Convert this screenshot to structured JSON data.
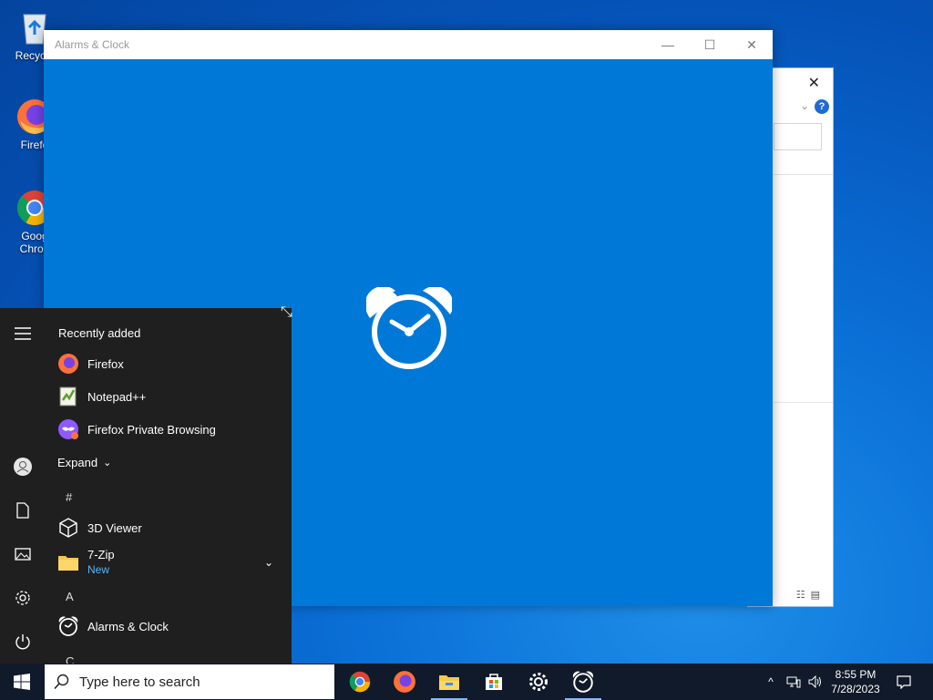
{
  "desktop": {
    "icons": [
      {
        "label": "Recycle",
        "icon": "recycle-bin-icon"
      },
      {
        "label": "Firefo",
        "icon": "firefox-icon"
      },
      {
        "label": "Goog Chron",
        "icon": "chrome-icon"
      }
    ]
  },
  "app_window": {
    "title": "Alarms & Clock",
    "minimize": "—",
    "maximize": "☐",
    "close": "✕",
    "accent": "#0078d7",
    "splash_icon": "alarm-clock-icon"
  },
  "background_window": {
    "close": "✕",
    "help": "?"
  },
  "start_menu": {
    "recently_added_label": "Recently added",
    "recent": [
      {
        "label": "Firefox",
        "icon": "firefox-icon"
      },
      {
        "label": "Notepad++",
        "icon": "notepad-plus-plus-icon"
      },
      {
        "label": "Firefox Private Browsing",
        "icon": "firefox-private-icon"
      }
    ],
    "expand_label": "Expand",
    "sections": [
      {
        "letter": "#",
        "apps": [
          {
            "label": "3D Viewer",
            "icon": "3d-viewer-icon"
          },
          {
            "label": "7-Zip",
            "badge": "New",
            "icon": "folder-icon"
          }
        ]
      },
      {
        "letter": "A",
        "apps": [
          {
            "label": "Alarms & Clock",
            "icon": "alarm-clock-icon"
          }
        ]
      },
      {
        "letter": "C",
        "apps": []
      }
    ]
  },
  "taskbar": {
    "search_placeholder": "Type here to search",
    "pinned": [
      "chrome-icon",
      "firefox-icon",
      "file-explorer-icon",
      "store-icon",
      "settings-icon",
      "alarm-clock-icon"
    ],
    "time": "8:55 PM",
    "date": "7/28/2023"
  }
}
